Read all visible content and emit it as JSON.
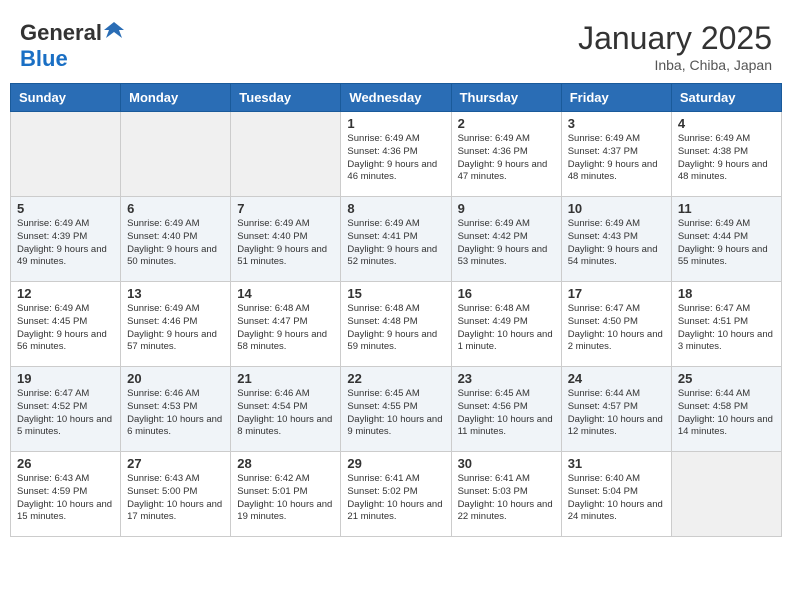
{
  "header": {
    "logo_general": "General",
    "logo_blue": "Blue",
    "month_title": "January 2025",
    "location": "Inba, Chiba, Japan"
  },
  "weekdays": [
    "Sunday",
    "Monday",
    "Tuesday",
    "Wednesday",
    "Thursday",
    "Friday",
    "Saturday"
  ],
  "weeks": [
    [
      {
        "day": "",
        "info": ""
      },
      {
        "day": "",
        "info": ""
      },
      {
        "day": "",
        "info": ""
      },
      {
        "day": "1",
        "info": "Sunrise: 6:49 AM\nSunset: 4:36 PM\nDaylight: 9 hours and 46 minutes."
      },
      {
        "day": "2",
        "info": "Sunrise: 6:49 AM\nSunset: 4:36 PM\nDaylight: 9 hours and 47 minutes."
      },
      {
        "day": "3",
        "info": "Sunrise: 6:49 AM\nSunset: 4:37 PM\nDaylight: 9 hours and 48 minutes."
      },
      {
        "day": "4",
        "info": "Sunrise: 6:49 AM\nSunset: 4:38 PM\nDaylight: 9 hours and 48 minutes."
      }
    ],
    [
      {
        "day": "5",
        "info": "Sunrise: 6:49 AM\nSunset: 4:39 PM\nDaylight: 9 hours and 49 minutes."
      },
      {
        "day": "6",
        "info": "Sunrise: 6:49 AM\nSunset: 4:40 PM\nDaylight: 9 hours and 50 minutes."
      },
      {
        "day": "7",
        "info": "Sunrise: 6:49 AM\nSunset: 4:40 PM\nDaylight: 9 hours and 51 minutes."
      },
      {
        "day": "8",
        "info": "Sunrise: 6:49 AM\nSunset: 4:41 PM\nDaylight: 9 hours and 52 minutes."
      },
      {
        "day": "9",
        "info": "Sunrise: 6:49 AM\nSunset: 4:42 PM\nDaylight: 9 hours and 53 minutes."
      },
      {
        "day": "10",
        "info": "Sunrise: 6:49 AM\nSunset: 4:43 PM\nDaylight: 9 hours and 54 minutes."
      },
      {
        "day": "11",
        "info": "Sunrise: 6:49 AM\nSunset: 4:44 PM\nDaylight: 9 hours and 55 minutes."
      }
    ],
    [
      {
        "day": "12",
        "info": "Sunrise: 6:49 AM\nSunset: 4:45 PM\nDaylight: 9 hours and 56 minutes."
      },
      {
        "day": "13",
        "info": "Sunrise: 6:49 AM\nSunset: 4:46 PM\nDaylight: 9 hours and 57 minutes."
      },
      {
        "day": "14",
        "info": "Sunrise: 6:48 AM\nSunset: 4:47 PM\nDaylight: 9 hours and 58 minutes."
      },
      {
        "day": "15",
        "info": "Sunrise: 6:48 AM\nSunset: 4:48 PM\nDaylight: 9 hours and 59 minutes."
      },
      {
        "day": "16",
        "info": "Sunrise: 6:48 AM\nSunset: 4:49 PM\nDaylight: 10 hours and 1 minute."
      },
      {
        "day": "17",
        "info": "Sunrise: 6:47 AM\nSunset: 4:50 PM\nDaylight: 10 hours and 2 minutes."
      },
      {
        "day": "18",
        "info": "Sunrise: 6:47 AM\nSunset: 4:51 PM\nDaylight: 10 hours and 3 minutes."
      }
    ],
    [
      {
        "day": "19",
        "info": "Sunrise: 6:47 AM\nSunset: 4:52 PM\nDaylight: 10 hours and 5 minutes."
      },
      {
        "day": "20",
        "info": "Sunrise: 6:46 AM\nSunset: 4:53 PM\nDaylight: 10 hours and 6 minutes."
      },
      {
        "day": "21",
        "info": "Sunrise: 6:46 AM\nSunset: 4:54 PM\nDaylight: 10 hours and 8 minutes."
      },
      {
        "day": "22",
        "info": "Sunrise: 6:45 AM\nSunset: 4:55 PM\nDaylight: 10 hours and 9 minutes."
      },
      {
        "day": "23",
        "info": "Sunrise: 6:45 AM\nSunset: 4:56 PM\nDaylight: 10 hours and 11 minutes."
      },
      {
        "day": "24",
        "info": "Sunrise: 6:44 AM\nSunset: 4:57 PM\nDaylight: 10 hours and 12 minutes."
      },
      {
        "day": "25",
        "info": "Sunrise: 6:44 AM\nSunset: 4:58 PM\nDaylight: 10 hours and 14 minutes."
      }
    ],
    [
      {
        "day": "26",
        "info": "Sunrise: 6:43 AM\nSunset: 4:59 PM\nDaylight: 10 hours and 15 minutes."
      },
      {
        "day": "27",
        "info": "Sunrise: 6:43 AM\nSunset: 5:00 PM\nDaylight: 10 hours and 17 minutes."
      },
      {
        "day": "28",
        "info": "Sunrise: 6:42 AM\nSunset: 5:01 PM\nDaylight: 10 hours and 19 minutes."
      },
      {
        "day": "29",
        "info": "Sunrise: 6:41 AM\nSunset: 5:02 PM\nDaylight: 10 hours and 21 minutes."
      },
      {
        "day": "30",
        "info": "Sunrise: 6:41 AM\nSunset: 5:03 PM\nDaylight: 10 hours and 22 minutes."
      },
      {
        "day": "31",
        "info": "Sunrise: 6:40 AM\nSunset: 5:04 PM\nDaylight: 10 hours and 24 minutes."
      },
      {
        "day": "",
        "info": ""
      }
    ]
  ]
}
